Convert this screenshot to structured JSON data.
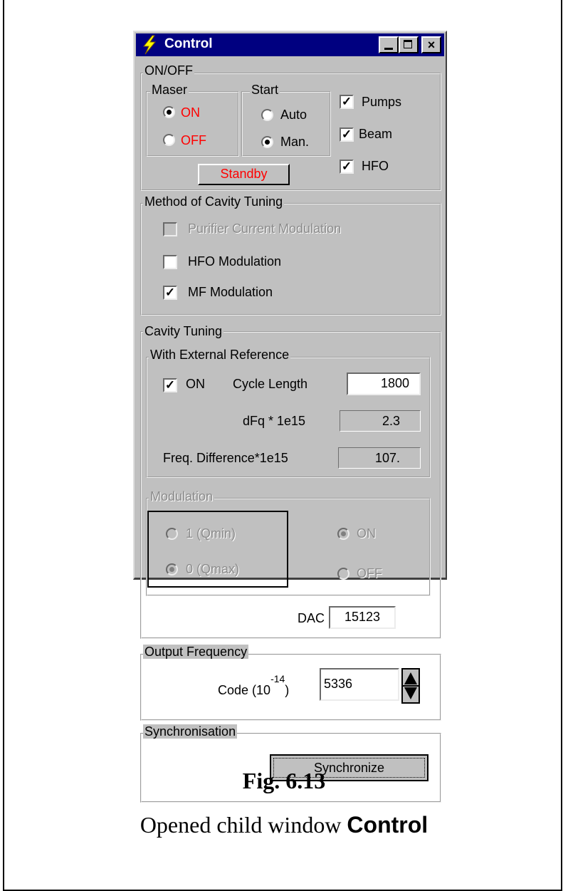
{
  "window": {
    "title": "Control",
    "close_glyph": "×"
  },
  "onoff": {
    "label": "ON/OFF",
    "maser": {
      "label": "Maser",
      "on_label": "ON",
      "off_label": "OFF",
      "selected": "ON"
    },
    "start": {
      "label": "Start",
      "auto_label": "Auto",
      "man_label": "Man.",
      "selected": "Man."
    },
    "pumps_label": "Pumps",
    "beam_label": "Beam",
    "hfo_label": "HFO",
    "checks": {
      "pumps": true,
      "beam": true,
      "hfo": true
    },
    "standby_label": "Standby"
  },
  "method": {
    "label": "Method of Cavity Tuning",
    "purifier_label": "Purifier Current Modulation",
    "hfo_mod_label": "HFO Modulation",
    "mf_mod_label": "MF Modulation",
    "checks": {
      "purifier": false,
      "hfo_mod": false,
      "mf_mod": true
    }
  },
  "cavity": {
    "label": "Cavity Tuning",
    "ext": {
      "label": "With External Reference",
      "on_label": "ON",
      "on_checked": true,
      "cycle_label": "Cycle Length",
      "cycle_value": "1800",
      "dfq_label": "dFq * 1e15",
      "dfq_value": "2.3",
      "freqdiff_label": "Freq. Difference*1e15",
      "freqdiff_value": "107."
    },
    "modulation": {
      "label": "Modulation",
      "q1_label": "1 (Qmin)",
      "q0_label": "0 (Qmax)",
      "on_label": "ON",
      "off_label": "OFF",
      "selected_q": "0 (Qmax)",
      "selected_state": "ON"
    },
    "dac_label": "DAC",
    "dac_value": "15123"
  },
  "output": {
    "label": "Output Frequency",
    "code_label": "Code (10",
    "code_exp": "-14",
    "code_close": ")",
    "code_value": "5336"
  },
  "sync": {
    "label": "Synchronisation",
    "button_label": "Synchronize"
  },
  "caption": {
    "fig": "Fig. 6.13",
    "text": "Opened child window ",
    "bold": "Control"
  },
  "colors": {
    "title_bar": "#000080",
    "window_face": "#c0c0c0",
    "alert_red": "#ff0000"
  }
}
